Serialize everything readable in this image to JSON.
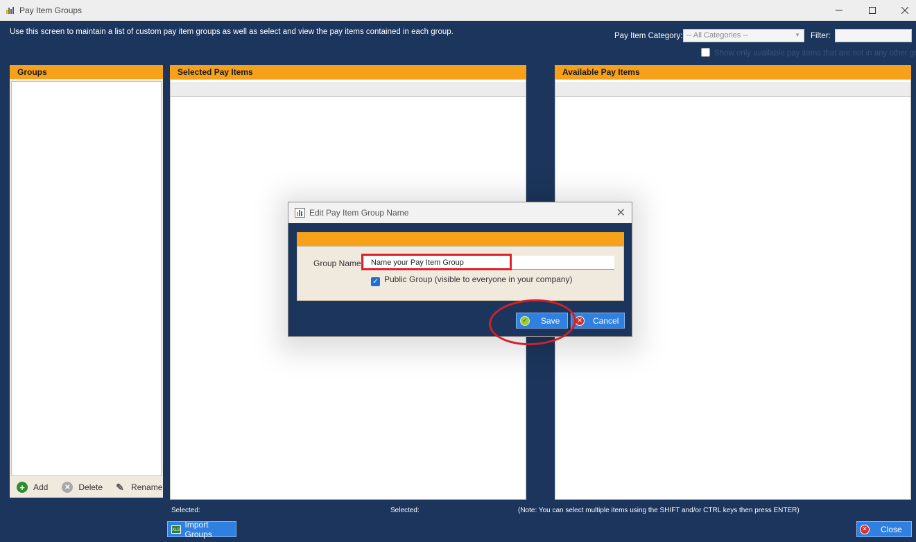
{
  "window": {
    "title": "Pay Item Groups"
  },
  "intro_text": "Use this screen to maintain a list of custom pay item groups as well as select and view the pay items contained in each group.",
  "filters": {
    "category_label": "Pay Item Category:",
    "category_value": "-- All Categories --",
    "filter_label": "Filter:",
    "show_only_label": "Show only available pay items that are not in any other group",
    "show_only_checked": false
  },
  "panels": {
    "groups_title": "Groups",
    "selected_title": "Selected Pay Items",
    "available_title": "Available Pay Items"
  },
  "groups_footer": {
    "add": "Add",
    "delete": "Delete",
    "rename": "Rename"
  },
  "status": {
    "selected_left": "Selected:",
    "selected_mid": "Selected:",
    "note": "(Note: You can select multiple items using the SHIFT and/or CTRL keys then press ENTER)"
  },
  "buttons": {
    "import_groups": "Import Groups",
    "close": "Close"
  },
  "dialog": {
    "title": "Edit Pay Item Group Name",
    "group_name_label": "Group Name:",
    "group_name_value": "Name your Pay Item Group",
    "public_label": "Public Group (visible to everyone in your company)",
    "public_checked": true,
    "save": "Save",
    "cancel": "Cancel"
  },
  "colors": {
    "background": "#1b355c",
    "accent": "#f7a11b",
    "button": "#2f80e0",
    "annotation": "#e0202a"
  }
}
